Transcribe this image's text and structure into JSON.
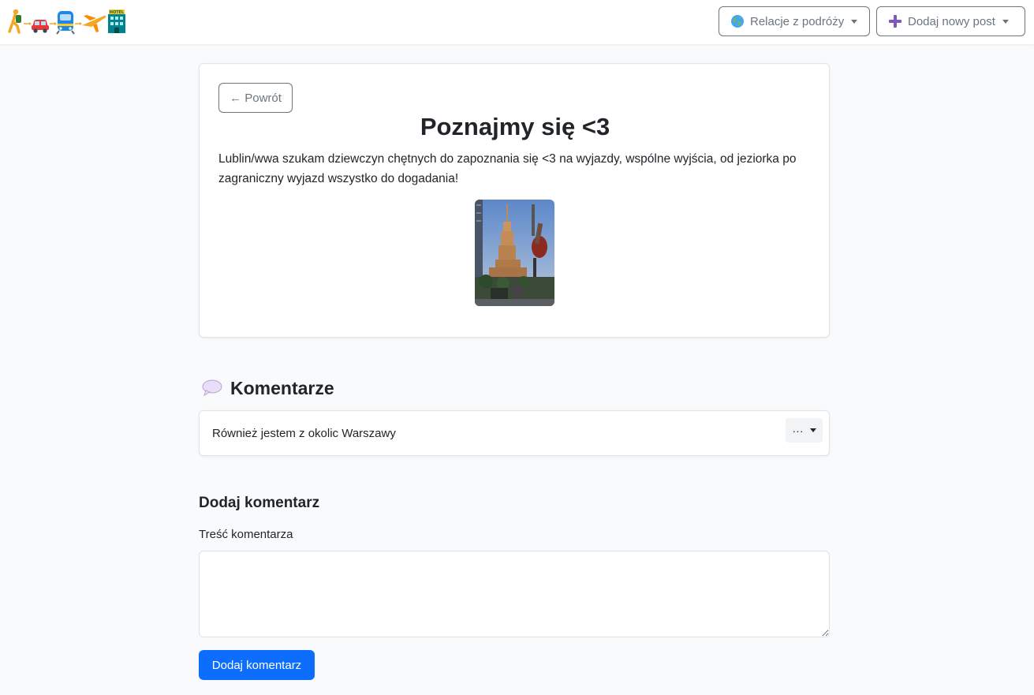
{
  "navbar": {
    "logo_icons": [
      "walking-person-icon",
      "car-icon",
      "train-icon",
      "airplane-icon",
      "hotel-icon"
    ],
    "logo_hotel_text": "HOTEL",
    "relacje_label": "Relacje z podróży",
    "relacje_icon": "globe-icon",
    "dodaj_label": "Dodaj nowy post",
    "dodaj_icon": "plus-icon"
  },
  "post": {
    "back_label": "← Powrót",
    "title": "Poznajmy się <3",
    "body": "Lublin/wwa szukam dziewczyn chętnych do zapoznania się <3 na wyjazdy, wspólne wyjścia, od jeziorka po zagraniczny wyjazd wszystko do dogadania!",
    "image": "photo-palace-of-culture-warsaw"
  },
  "comments": {
    "heading": "Komentarze",
    "heading_icon": "speech-bubble-icon",
    "items": [
      {
        "text": "Również jestem z okolic Warszawy",
        "menu_label": "···"
      }
    ]
  },
  "add_comment": {
    "heading": "Dodaj komentarz",
    "field_label": "Treść komentarza",
    "value": "",
    "submit_label": "Dodaj komentarz"
  },
  "colors": {
    "background": "#f8fafb",
    "primary": "#0d6efd",
    "secondary": "#6c757d"
  }
}
